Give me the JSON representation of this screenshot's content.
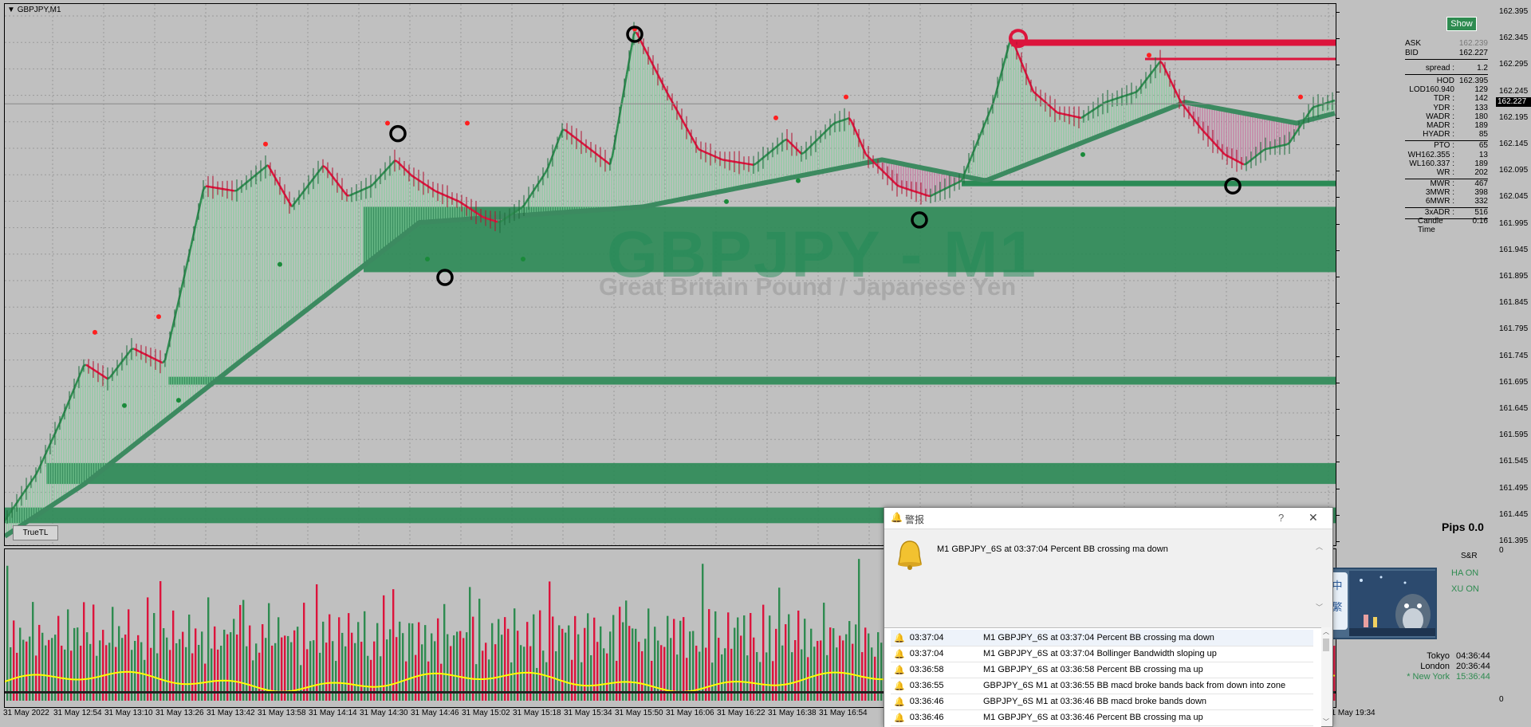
{
  "chart": {
    "title": "GBPJPY,M1",
    "watermark_title": "GBPJPY - M1",
    "watermark_subtitle": "Great Britain Pound / Japanese Yen",
    "show_button": "Show",
    "truetl_button": "TrueTL",
    "pips_label": "Pips 0.0",
    "current_price": "162.227",
    "price_levels": [
      "162.395",
      "162.345",
      "162.295",
      "162.245",
      "162.195",
      "162.145",
      "162.095",
      "162.045",
      "161.995",
      "161.945",
      "161.895",
      "161.845",
      "161.795",
      "161.745",
      "161.695",
      "161.645",
      "161.595",
      "161.545",
      "161.495",
      "161.445",
      "161.395"
    ],
    "time_labels": [
      "31 May 2022",
      "31 May 12:54",
      "31 May 13:10",
      "31 May 13:26",
      "31 May 13:42",
      "31 May 13:58",
      "31 May 14:14",
      "31 May 14:30",
      "31 May 14:46",
      "31 May 15:02",
      "31 May 15:18",
      "31 May 15:34",
      "31 May 15:50",
      "31 May 16:06",
      "31 May 16:22",
      "31 May 16:38",
      "31 May 16:54",
      "31 May 19:34"
    ],
    "sub_axis_top": "0",
    "sub_axis_bottom": "0"
  },
  "info_panel": {
    "ask_label": "ASK",
    "ask_value": "162.239",
    "bid_label": "BID",
    "bid_value": "162.227",
    "rows": [
      {
        "label": "spread :",
        "value": "1.2"
      },
      {
        "label": "HOD",
        "value": "162.395"
      },
      {
        "label": "LOD160.940 :",
        "value": "129"
      },
      {
        "label": "TDR :",
        "value": "142"
      },
      {
        "label": "YDR :",
        "value": "133"
      },
      {
        "label": "WADR :",
        "value": "180"
      },
      {
        "label": "MADR :",
        "value": "189"
      },
      {
        "label": "HYADR :",
        "value": "85"
      },
      {
        "label": "PTO :",
        "value": "65"
      },
      {
        "label": "WH162.355 :",
        "value": "13"
      },
      {
        "label": "WL160.337 :",
        "value": "189"
      },
      {
        "label": "WR :",
        "value": "202"
      },
      {
        "label": "MWR :",
        "value": "467"
      },
      {
        "label": "3MWR :",
        "value": "398"
      },
      {
        "label": "6MWR :",
        "value": "332"
      },
      {
        "label": "3xADR :",
        "value": "516"
      }
    ],
    "candle_time_label": "Candle Time",
    "candle_time_value": "0:16"
  },
  "right_panel": {
    "sr_label": "S&R",
    "ha_on": "HA ON",
    "xu_on": "XU ON",
    "lang_chars": [
      "中",
      "繁"
    ],
    "sessions": [
      {
        "city": "Tokyo",
        "time": "04:36:44"
      },
      {
        "city": "London",
        "time": "20:36:44"
      },
      {
        "city": "* New York",
        "time": "15:36:44"
      }
    ]
  },
  "alert_dialog": {
    "title": "警报",
    "help": "?",
    "close": "✕",
    "main_message": "M1 GBPJPY_6S at 03:37:04 Percent BB crossing ma down",
    "rows": [
      {
        "time": "03:37:04",
        "message": "M1 GBPJPY_6S at 03:37:04 Percent BB crossing ma down"
      },
      {
        "time": "03:37:04",
        "message": "M1 GBPJPY_6S at 03:37:04 Bollinger Bandwidth  sloping up"
      },
      {
        "time": "03:36:58",
        "message": "M1 GBPJPY_6S at 03:36:58 Percent BB crossing ma up"
      },
      {
        "time": "03:36:55",
        "message": "GBPJPY_6S M1 at 03:36:55 BB macd broke bands back from down into zone"
      },
      {
        "time": "03:36:46",
        "message": "GBPJPY_6S M1 at 03:36:46 BB macd broke bands down"
      },
      {
        "time": "03:36:46",
        "message": "M1 GBPJPY_6S at 03:36:46 Percent BB crossing ma up"
      }
    ]
  },
  "colors": {
    "bull": "#2e8b50",
    "bear": "#dc143c",
    "zone": "#2b8a55",
    "ma": "#3c8a60",
    "volume_avg": "#ffff00"
  }
}
